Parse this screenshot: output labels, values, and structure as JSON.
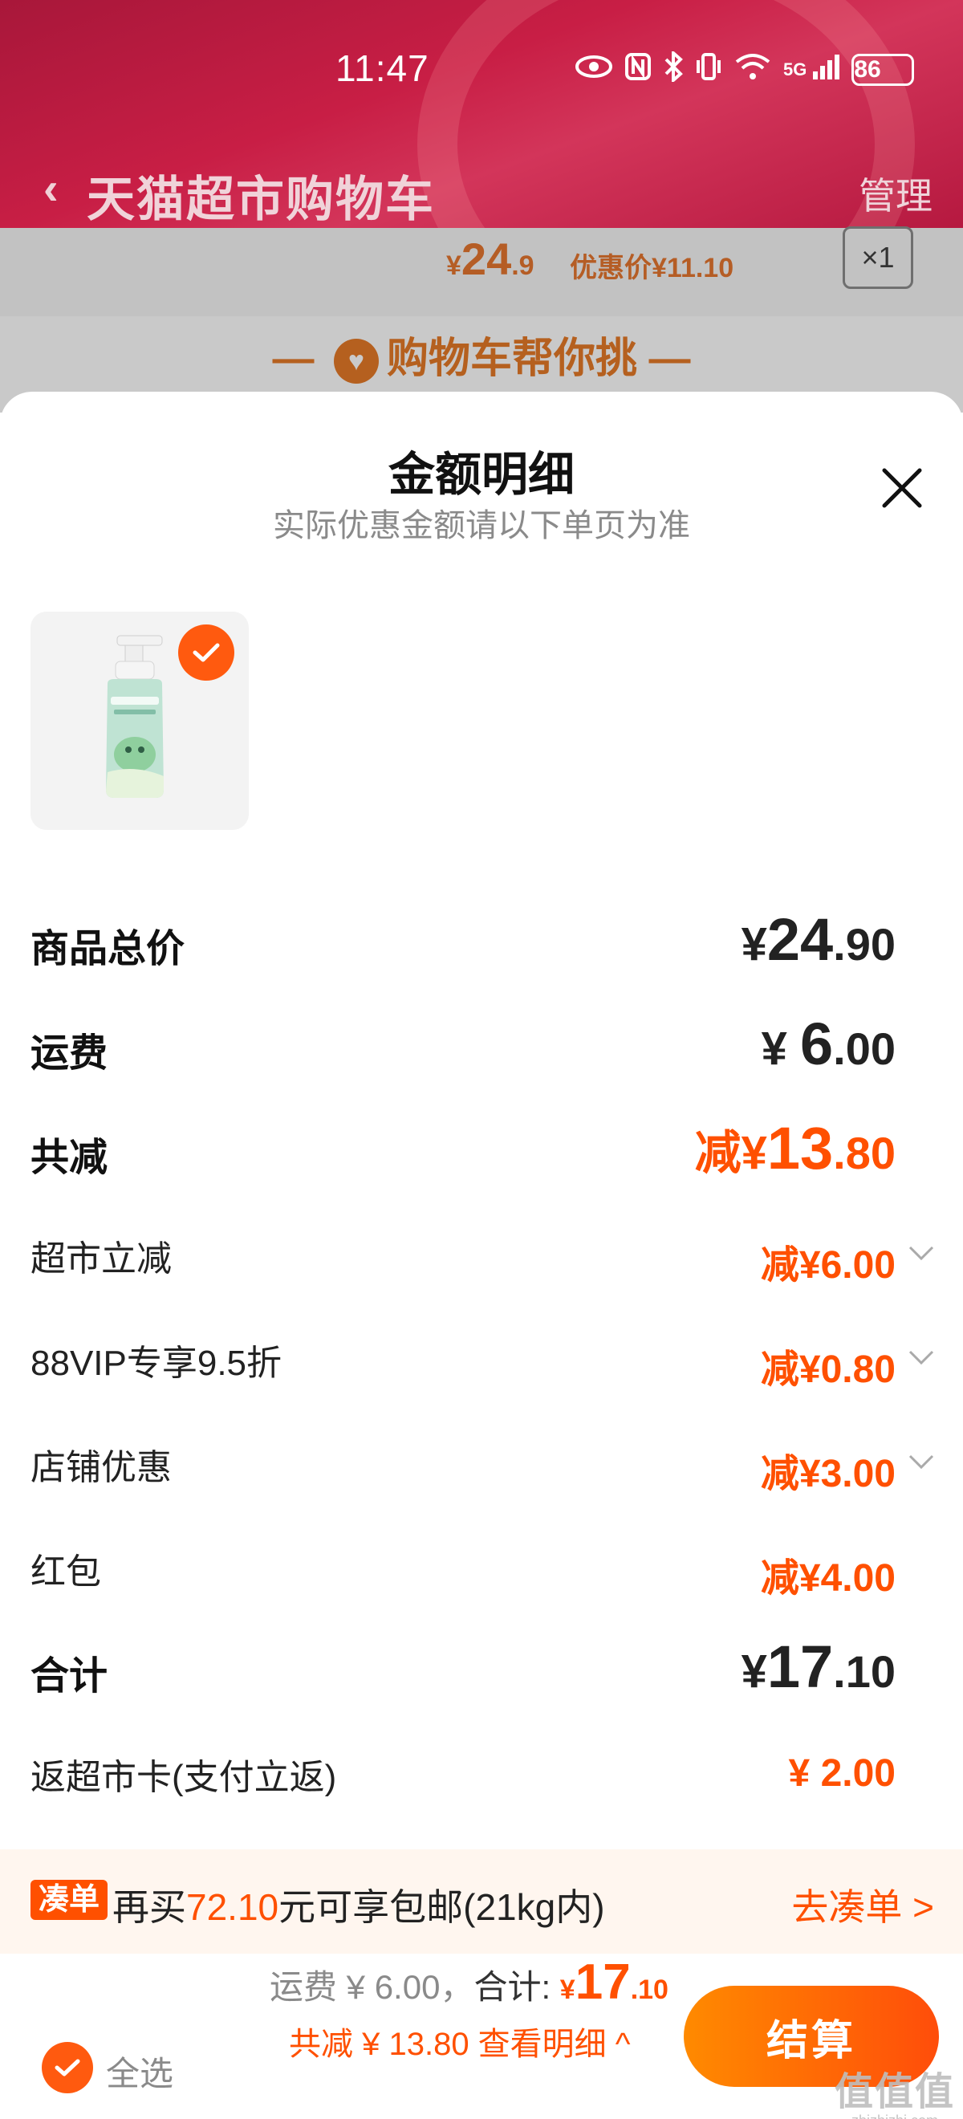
{
  "status_bar": {
    "time": "11:47",
    "network": "5G",
    "battery": "86"
  },
  "nav": {
    "back_icon": "chevron-left-icon",
    "title": "天猫超市购物车",
    "manage": "管理"
  },
  "background_item": {
    "price_currency": "¥",
    "price_int": "24",
    "price_dec": ".9",
    "discount_label": "优惠价¥11.10",
    "qty": "×1"
  },
  "helper": {
    "text": "购物车帮你挑"
  },
  "sheet": {
    "title": "金额明细",
    "subtitle": "实际优惠金额请以下单页为准",
    "close_icon": "close-icon"
  },
  "product": {
    "selected": true
  },
  "rows": [
    {
      "label": "商品总价",
      "value_cur": "¥",
      "value_int": "24",
      "value_dec": ".90"
    },
    {
      "label": "运费",
      "value_cur": "¥ ",
      "value_int": "6",
      "value_dec": ".00"
    },
    {
      "label": "共减",
      "value_cur": "减¥",
      "value_int": "13",
      "value_dec": ".80"
    },
    {
      "label": "超市立减",
      "value": "减¥6.00"
    },
    {
      "label": "88VIP专享9.5折",
      "value": "减¥0.80"
    },
    {
      "label": "店铺优惠",
      "value": "减¥3.00"
    },
    {
      "label": "红包",
      "value": "减¥4.00"
    },
    {
      "label": "合计",
      "value_cur": "¥",
      "value_int": "17",
      "value_dec": ".10"
    },
    {
      "label": "返超市卡(支付立返)",
      "value": "¥ 2.00"
    }
  ],
  "promo": {
    "tag": "凑单",
    "text_before": "再买",
    "amount": "72.10",
    "text_after": "元可享包邮(21kg内)",
    "link": "去凑单 >"
  },
  "footer": {
    "select_all": "全选",
    "shipping": "运费 ¥ 6.00，",
    "total_label": "合计: ",
    "total_cur": "¥",
    "total_int": "17",
    "total_dec": ".10",
    "saving": "共减 ¥ 13.80 查看明细 ^",
    "checkout": "结算"
  },
  "colors": {
    "accent": "#ff5000",
    "header": "#c81e45"
  }
}
